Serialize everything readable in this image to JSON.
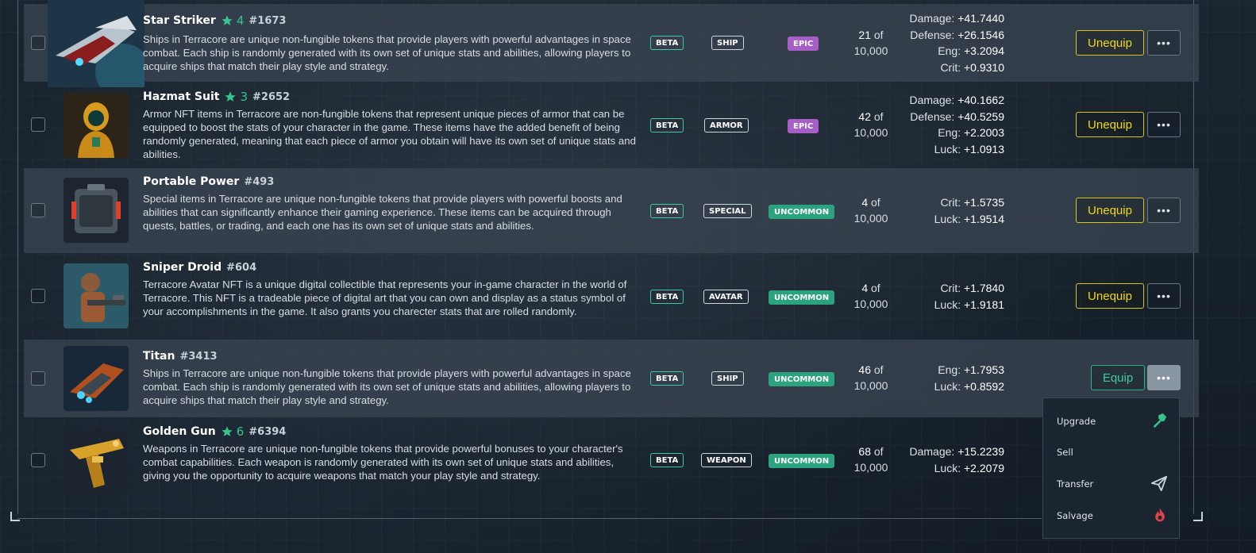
{
  "items": [
    {
      "name": "Star Striker",
      "level": "4",
      "number": "#1673",
      "description": "Ships in Terracore are unique non-fungible tokens that provide players with powerful advantages in space combat. Each ship is randomly generated with its own set of unique stats and abilities, allowing players to acquire ships that match their play style and strategy.",
      "badges": {
        "beta": "BETA",
        "type": "SHIP",
        "rarity": "EPIC"
      },
      "supply": {
        "count": "21",
        "of": "of",
        "total": "10,000"
      },
      "stats": [
        {
          "label": "Damage:",
          "value": "+41.7440"
        },
        {
          "label": "Defense:",
          "value": "+26.1546"
        },
        {
          "label": "Eng:",
          "value": "+3.2094"
        },
        {
          "label": "Crit:",
          "value": "+0.9310"
        }
      ],
      "action": "Unequip",
      "more": "•••",
      "image_icon": "spaceship-icon"
    },
    {
      "name": "Hazmat Suit",
      "level": "3",
      "number": "#2652",
      "description": "Armor NFT items in Terracore are non-fungible tokens that represent unique pieces of armor that can be equipped to boost the stats of your character in the game. These items have the added benefit of being randomly generated, meaning that each piece of armor you obtain will have its own set of unique stats and abilities.",
      "badges": {
        "beta": "BETA",
        "type": "ARMOR",
        "rarity": "EPIC"
      },
      "supply": {
        "count": "42",
        "of": "of",
        "total": "10,000"
      },
      "stats": [
        {
          "label": "Damage:",
          "value": "+40.1662"
        },
        {
          "label": "Defense:",
          "value": "+40.5259"
        },
        {
          "label": "Eng:",
          "value": "+2.2003"
        },
        {
          "label": "Luck:",
          "value": "+1.0913"
        }
      ],
      "action": "Unequip",
      "more": "•••",
      "image_icon": "hazmat-suit-icon"
    },
    {
      "name": "Portable Power",
      "level": "",
      "number": "#493",
      "description": "Special items in Terracore are unique non-fungible tokens that provide players with powerful boosts and abilities that can significantly enhance their gaming experience. These items can be acquired through quests, battles, or trading, and each one has its own set of unique stats and abilities.",
      "badges": {
        "beta": "BETA",
        "type": "SPECIAL",
        "rarity": "UNCOMMON"
      },
      "supply": {
        "count": "4",
        "of": "of",
        "total": "10,000"
      },
      "stats": [
        {
          "label": "Crit:",
          "value": "+1.5735"
        },
        {
          "label": "Luck:",
          "value": "+1.9514"
        }
      ],
      "action": "Unequip",
      "more": "•••",
      "image_icon": "power-cell-icon"
    },
    {
      "name": "Sniper Droid",
      "level": "",
      "number": "#604",
      "description": "Terracore Avatar NFT is a unique digital collectible that represents your in-game character in the world of Terracore. This NFT is a tradeable piece of digital art that you can own and display as a status symbol of your accomplishments in the game. It also grants you charecter stats that are rolled randomly.",
      "badges": {
        "beta": "BETA",
        "type": "AVATAR",
        "rarity": "UNCOMMON"
      },
      "supply": {
        "count": "4",
        "of": "of",
        "total": "10,000"
      },
      "stats": [
        {
          "label": "Crit:",
          "value": "+1.7840"
        },
        {
          "label": "Luck:",
          "value": "+1.9181"
        }
      ],
      "action": "Unequip",
      "more": "•••",
      "image_icon": "droid-avatar-icon"
    },
    {
      "name": "Titan",
      "level": "",
      "number": "#3413",
      "description": "Ships in Terracore are unique non-fungible tokens that provide players with powerful advantages in space combat. Each ship is randomly generated with its own set of unique stats and abilities, allowing players to acquire ships that match their play style and strategy.",
      "badges": {
        "beta": "BETA",
        "type": "SHIP",
        "rarity": "UNCOMMON"
      },
      "supply": {
        "count": "46",
        "of": "of",
        "total": "10,000"
      },
      "stats": [
        {
          "label": "Eng:",
          "value": "+1.7953"
        },
        {
          "label": "Luck:",
          "value": "+0.8592"
        }
      ],
      "action": "Equip",
      "more": "•••",
      "image_icon": "spaceship-icon"
    },
    {
      "name": "Golden Gun",
      "level": "6",
      "number": "#6394",
      "description": "Weapons in Terracore are unique non-fungible tokens that provide powerful bonuses to your character's combat capabilities. Each weapon is randomly generated with its own set of unique stats and abilities, giving you the opportunity to acquire weapons that match your play style and strategy.",
      "badges": {
        "beta": "BETA",
        "type": "WEAPON",
        "rarity": "UNCOMMON"
      },
      "supply": {
        "count": "68",
        "of": "of",
        "total": "10,000"
      },
      "stats": [
        {
          "label": "Damage:",
          "value": "+15.2239"
        },
        {
          "label": "Luck:",
          "value": "+2.2079"
        }
      ],
      "action": "",
      "more": "",
      "image_icon": "gun-icon"
    }
  ],
  "context_menu": [
    {
      "label": "Upgrade",
      "icon": "hammer-icon",
      "icon_color": "#35c48c"
    },
    {
      "label": "Sell",
      "icon": "",
      "icon_color": ""
    },
    {
      "label": "Transfer",
      "icon": "paper-plane-icon",
      "icon_color": "#c9d2da"
    },
    {
      "label": "Salvage",
      "icon": "flame-icon",
      "icon_color": "#e0444a"
    }
  ],
  "colors": {
    "accent_green": "#35c48c",
    "epic_purple": "#a55fc6",
    "uncommon_green": "#2aa37e",
    "unequip_yellow": "#f0d51e"
  }
}
